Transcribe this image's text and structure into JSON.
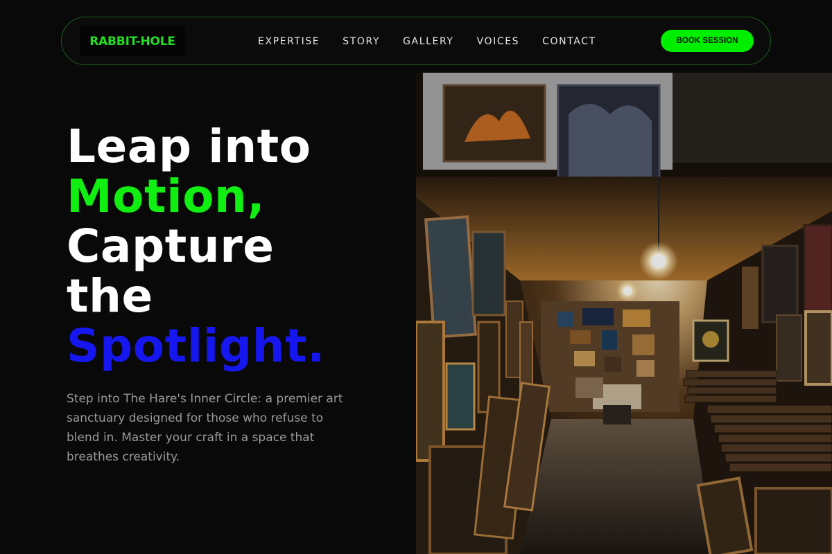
{
  "brand": {
    "logo_text": "RABBIT-HOLE",
    "accent_green": "#00ee00",
    "accent_blue": "#1616ee"
  },
  "nav": {
    "links": [
      {
        "label": "EXPERTISE"
      },
      {
        "label": "STORY"
      },
      {
        "label": "GALLERY"
      },
      {
        "label": "VOICES"
      },
      {
        "label": "CONTACT"
      }
    ],
    "cta_label": "BOOK SESSION"
  },
  "hero": {
    "heading_lines": [
      {
        "text": "Leap into",
        "color": "white"
      },
      {
        "text": "Motion,",
        "color": "green"
      },
      {
        "text": "Capture",
        "color": "white"
      },
      {
        "text": "the",
        "color": "white"
      },
      {
        "text": "Spotlight.",
        "color": "blue"
      }
    ],
    "description": "Step into The Hare's Inner Circle: a premier art sanctuary designed for those who refuse to blend in. Master your craft in a space that breathes creativity."
  },
  "image": {
    "subject": "art-gallery-corridor-photo"
  }
}
